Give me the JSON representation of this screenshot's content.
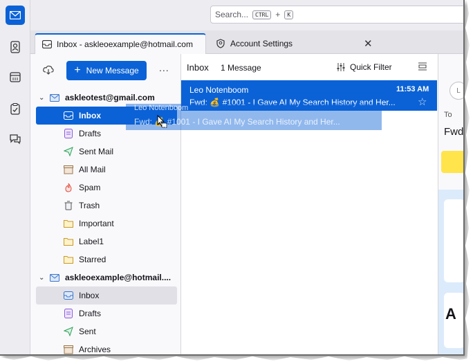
{
  "search": {
    "placeholder": "Search...",
    "shortcut_mod": "CTRL",
    "shortcut_plus": "+",
    "shortcut_key": "K"
  },
  "tabs": [
    {
      "label": "Inbox - askleoexample@hotmail.com"
    },
    {
      "label": "Account Settings"
    }
  ],
  "folder_pane": {
    "new_message_label": "New Message",
    "more_label": "..."
  },
  "accounts": [
    {
      "name": "askleotest@gmail.com",
      "folders": [
        "Inbox",
        "Drafts",
        "Sent Mail",
        "All Mail",
        "Spam",
        "Trash",
        "Important",
        "Label1",
        "Starred"
      ]
    },
    {
      "name": "askleoexample@hotmail....",
      "folders": [
        "Inbox",
        "Drafts",
        "Sent",
        "Archives"
      ]
    }
  ],
  "message_list": {
    "title": "Inbox",
    "count": "1 Message",
    "quick_filter_label": "Quick Filter",
    "messages": [
      {
        "sender": "Leo Notenboom",
        "time": "11:53 AM",
        "subject": "Fwd: 💰 #1001 - I Gave AI My Search History and Her..."
      }
    ]
  },
  "drag_ghost": {
    "sender": "Leo Notenboom",
    "subject": "Fwd: 💰 #1001 - I Gave AI My Search History and Her..."
  },
  "reader": {
    "avatar_initial": "L",
    "to_label": "To",
    "subject": "Fwd",
    "body_glyph": "A"
  },
  "colors": {
    "accent": "#0b62d6",
    "selection_grey": "#e0e0e6",
    "note_yellow": "#ffe44c"
  }
}
